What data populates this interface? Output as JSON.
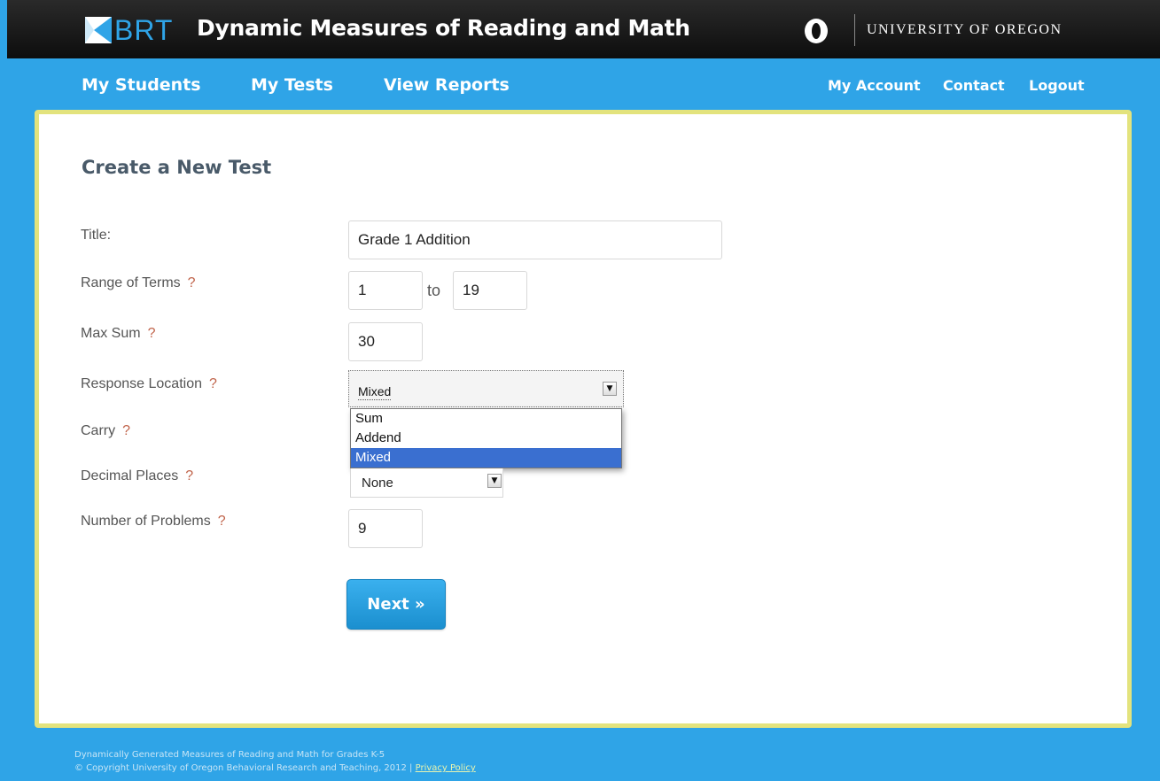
{
  "header": {
    "brt_logo_text": "BRT",
    "app_title": "Dynamic Measures of Reading and Math",
    "university": "UNIVERSITY OF OREGON"
  },
  "nav": {
    "left": [
      "My Students",
      "My Tests",
      "View Reports"
    ],
    "right": [
      "My Account",
      "Contact",
      "Logout"
    ]
  },
  "form": {
    "title": "Create a New Test",
    "help_mark": "?",
    "fields": {
      "title": {
        "label": "Title:",
        "value": "Grade 1 Addition"
      },
      "range": {
        "label": "Range of Terms",
        "from": "1",
        "to_label": "to",
        "to": "19"
      },
      "max_sum": {
        "label": "Max Sum",
        "value": "30"
      },
      "response_location": {
        "label": "Response Location",
        "value": "Mixed",
        "options": [
          "Sum",
          "Addend",
          "Mixed"
        ],
        "selected": "Mixed"
      },
      "carry": {
        "label": "Carry"
      },
      "decimal_places": {
        "label": "Decimal Places",
        "value": "None"
      },
      "num_problems": {
        "label": "Number of Problems",
        "value": "9"
      }
    },
    "next_label": "Next »"
  },
  "footer": {
    "line1": "Dynamically Generated Measures of Reading and Math for Grades K-5",
    "line2": "© Copyright University of Oregon Behavioral Research and Teaching, 2012 |",
    "privacy": "Privacy Policy"
  },
  "colors": {
    "background": "#2fa4e7",
    "panel_border": "#e3e37d",
    "help_mark": "#c0634a",
    "selected_option": "#3a6fd0"
  }
}
